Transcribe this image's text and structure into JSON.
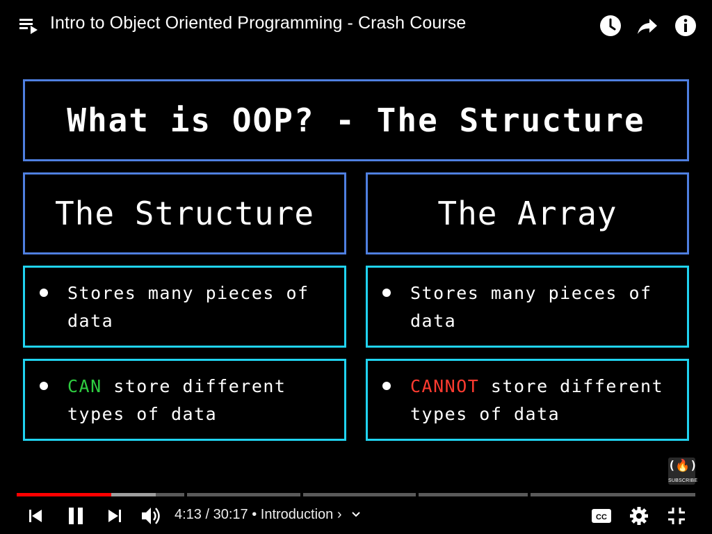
{
  "header": {
    "title": "Intro to Object Oriented Programming - Crash Course",
    "icons": [
      "playlist-icon",
      "watch-later-icon",
      "share-icon",
      "info-icon"
    ]
  },
  "slide": {
    "title": "What is OOP? - The Structure",
    "left_heading": "The Structure",
    "right_heading": "The Array",
    "left_bullets": [
      {
        "emphasis": "",
        "text": "Stores many pieces of data"
      },
      {
        "emphasis": "CAN",
        "text": " store different types of data"
      }
    ],
    "right_bullets": [
      {
        "emphasis": "",
        "text": "Stores many pieces of data"
      },
      {
        "emphasis": "CANNOT",
        "text": " store different types of data"
      }
    ],
    "colors": {
      "box_blue": "#4f7fe0",
      "box_cyan": "#20d3f0",
      "can": "#2ecc40",
      "cannot": "#ff3b30"
    }
  },
  "channel": {
    "logo_glyph": "(🔥)",
    "subscribe_label": "SUBSCRIBE"
  },
  "player": {
    "current_time": "4:13",
    "duration": "30:17",
    "time_display": "4:13 / 30:17 • Introduction ›",
    "chapter": "Introduction",
    "progress_fraction": 0.139,
    "buffered_fraction": 0.205,
    "progress_color": "#ff0000",
    "controls": [
      "previous-icon",
      "pause-icon",
      "next-icon",
      "volume-icon",
      "captions-icon",
      "settings-icon",
      "exit-fullscreen-icon"
    ]
  }
}
